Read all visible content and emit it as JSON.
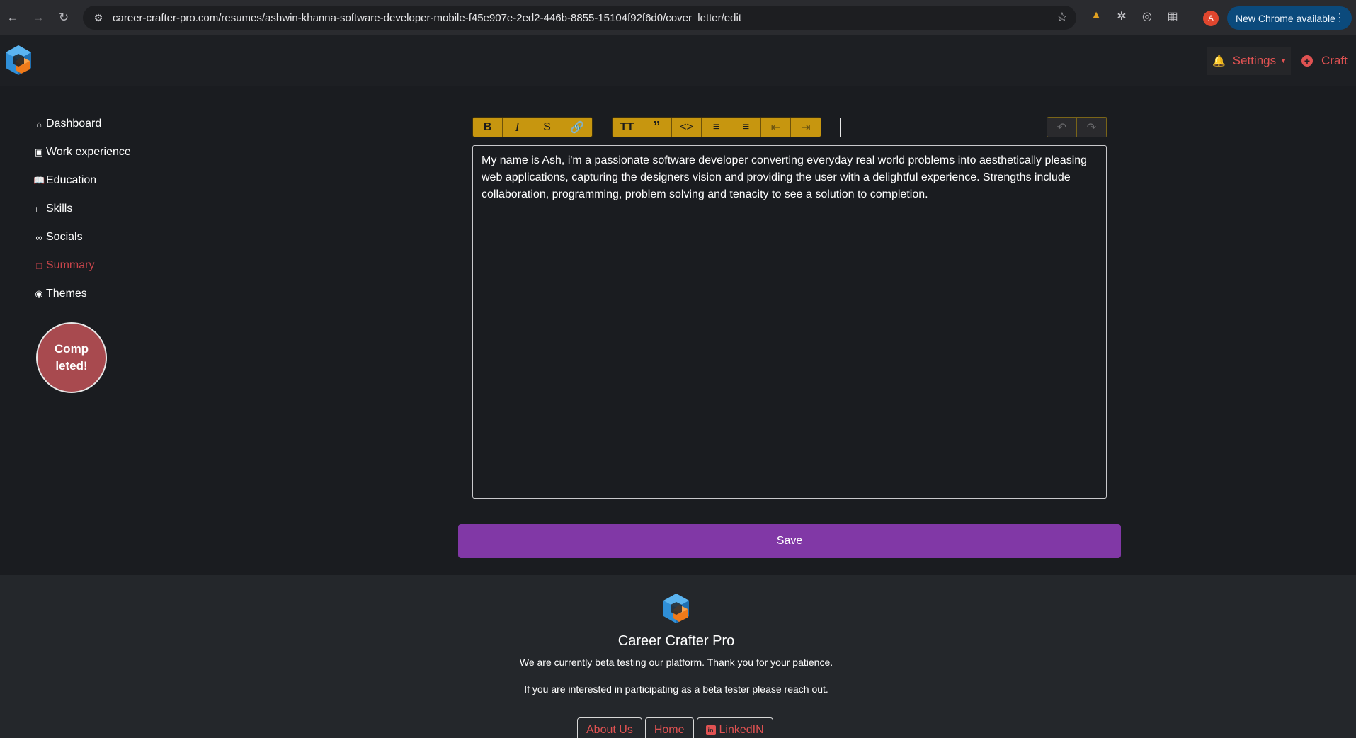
{
  "browser": {
    "url": "career-crafter-pro.com/resumes/ashwin-khanna-software-developer-mobile-f45e907e-2ed2-446b-8855-15104f92f6d0/cover_letter/edit",
    "profile_initial": "A",
    "update_label": "New Chrome available"
  },
  "header": {
    "settings_label": "Settings",
    "craft_label": "Craft"
  },
  "sidebar": {
    "items": [
      {
        "label": "Dashboard",
        "icon": "home-icon"
      },
      {
        "label": "Work experience",
        "icon": "briefcase-icon"
      },
      {
        "label": "Education",
        "icon": "book-icon"
      },
      {
        "label": "Skills",
        "icon": "chart-icon"
      },
      {
        "label": "Socials",
        "icon": "link-icon"
      },
      {
        "label": "Summary",
        "icon": "document-icon",
        "active": true
      },
      {
        "label": "Themes",
        "icon": "palette-icon"
      }
    ],
    "completed_badge": "Comp leted!"
  },
  "editor": {
    "toolbar_groups": [
      [
        "bold",
        "italic",
        "strikethrough",
        "link"
      ],
      [
        "heading",
        "quote",
        "code",
        "bullet-list",
        "numbered-list",
        "outdent",
        "indent"
      ],
      [
        "undo",
        "redo"
      ]
    ],
    "content": "My name is Ash, i'm a passionate software developer converting everyday real world problems into aesthetically pleasing web applications, capturing the designers vision and providing the user with a delightful experience. Strengths include collaboration, programming, problem solving and tenacity to see a solution to completion."
  },
  "save_label": "Save",
  "footer": {
    "title": "Career Crafter Pro",
    "line1": "We are currently beta testing our platform. Thank you for your patience.",
    "line2": "If you are interested in participating as a beta tester please reach out.",
    "links": [
      "About Us",
      "Home",
      "LinkedIN"
    ]
  },
  "colors": {
    "accent_red": "#e05252",
    "toolbar_gold": "#c7960f",
    "save_purple": "#8138a6",
    "badge_red": "#a84a4f"
  }
}
